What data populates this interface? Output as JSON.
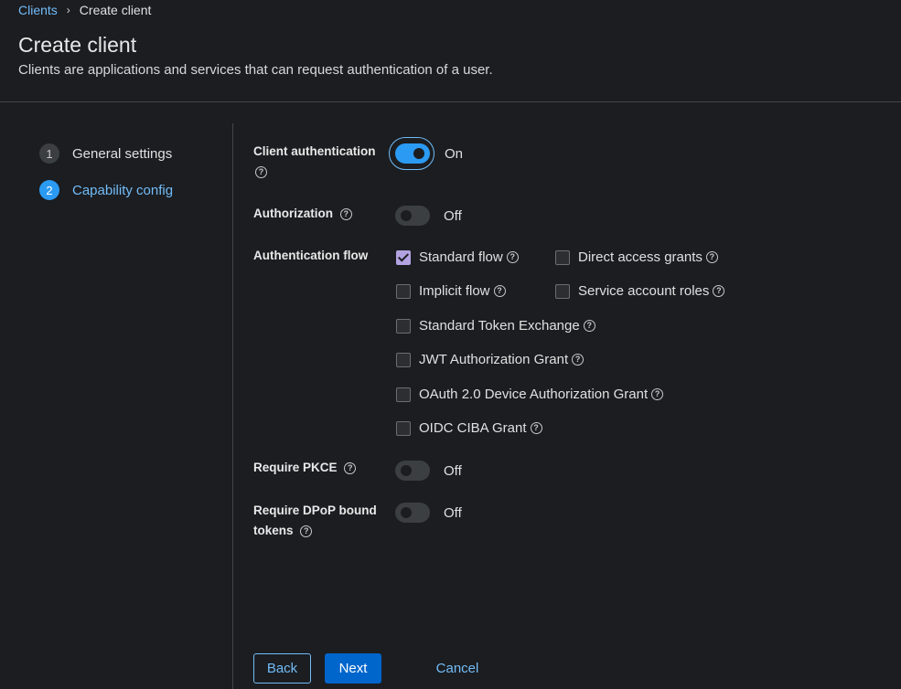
{
  "breadcrumb": {
    "link": "Clients",
    "current": "Create client"
  },
  "header": {
    "title": "Create client",
    "description": "Clients are applications and services that can request authentication of a user."
  },
  "steps": [
    {
      "num": "1",
      "label": "General settings"
    },
    {
      "num": "2",
      "label": "Capability config"
    }
  ],
  "fields": {
    "client_auth": {
      "label": "Client authentication",
      "state": "On"
    },
    "authorization": {
      "label": "Authorization",
      "state": "Off"
    },
    "auth_flow": {
      "label": "Authentication flow"
    },
    "pkce": {
      "label": "Require PKCE",
      "state": "Off"
    },
    "dpop": {
      "label_line1": "Require DPoP bound",
      "label_line2": "tokens",
      "state": "Off"
    }
  },
  "flows": {
    "standard": "Standard flow",
    "direct": "Direct access grants",
    "implicit": "Implicit flow",
    "service": "Service account roles",
    "token_exchange": "Standard Token Exchange",
    "jwt": "JWT Authorization Grant",
    "device": "OAuth 2.0 Device Authorization Grant",
    "ciba": "OIDC CIBA Grant"
  },
  "buttons": {
    "back": "Back",
    "next": "Next",
    "cancel": "Cancel"
  },
  "icons": {
    "help": "?",
    "chevron": "›"
  },
  "colors": {
    "accent": "#2b9af3",
    "link": "#73bcf7",
    "primary": "#0066cc",
    "checkbox": "#b2a3e0"
  }
}
